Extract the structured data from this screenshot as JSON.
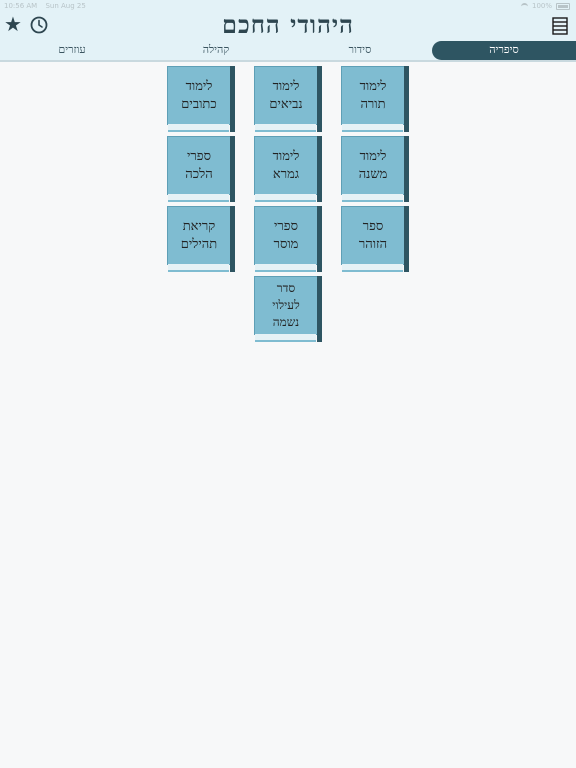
{
  "status": {
    "time": "10:56 AM",
    "date": "Sun Aug 25",
    "battery": "100%"
  },
  "header": {
    "title": "היהודי החכם"
  },
  "tabs": [
    {
      "label": "סיפריה",
      "active": true
    },
    {
      "label": "סידור",
      "active": false
    },
    {
      "label": "קהילה",
      "active": false
    },
    {
      "label": "עוזרים",
      "active": false
    }
  ],
  "books": [
    {
      "label": "לימוד\nתורה"
    },
    {
      "label": "לימוד\nנביאים"
    },
    {
      "label": "לימוד\nכתובים"
    },
    {
      "label": "לימוד\nמשנה"
    },
    {
      "label": "לימוד\nגמרא"
    },
    {
      "label": "ספרי\nהלכה"
    },
    {
      "label": "ספר\nהזוהר"
    },
    {
      "label": "ספרי\nמוסר"
    },
    {
      "label": "קריאת\nתהילים"
    },
    {
      "label": "סדר\nלעילוי\nנשמה"
    }
  ],
  "colors": {
    "accent": "#2e5562",
    "book": "#7fbcd1",
    "header": "#e3f2f7"
  }
}
